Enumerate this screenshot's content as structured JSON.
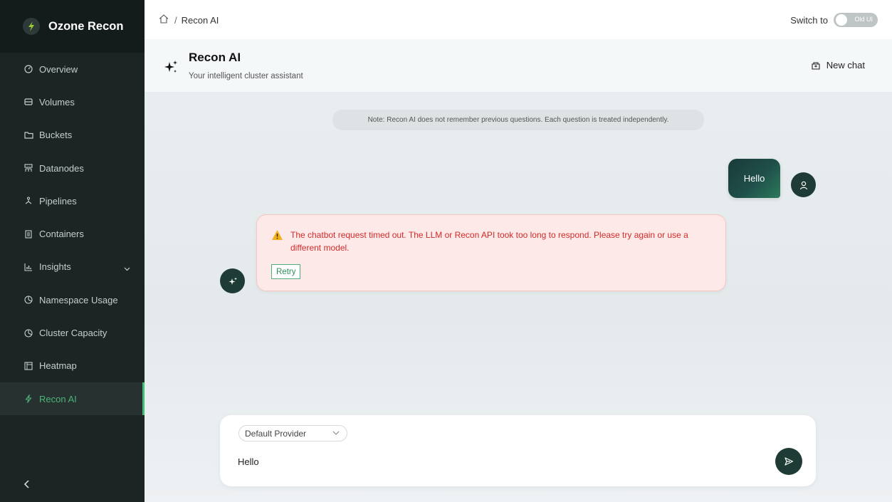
{
  "app": {
    "name": "Ozone Recon"
  },
  "sidebar": {
    "items": [
      {
        "label": "Overview",
        "icon": "dashboard-icon"
      },
      {
        "label": "Volumes",
        "icon": "volume-icon"
      },
      {
        "label": "Buckets",
        "icon": "folder-icon"
      },
      {
        "label": "Datanodes",
        "icon": "cluster-icon"
      },
      {
        "label": "Pipelines",
        "icon": "pipeline-icon"
      },
      {
        "label": "Containers",
        "icon": "container-icon"
      },
      {
        "label": "Insights",
        "icon": "chart-icon",
        "expandable": true
      },
      {
        "label": "Namespace Usage",
        "icon": "pie-icon"
      },
      {
        "label": "Cluster Capacity",
        "icon": "pie-icon"
      },
      {
        "label": "Heatmap",
        "icon": "heatmap-icon"
      },
      {
        "label": "Recon AI",
        "icon": "bolt-icon",
        "active": true
      }
    ]
  },
  "topbar": {
    "breadcrumb": "Recon AI",
    "switch_label": "Switch to",
    "toggle_label": "Old UI"
  },
  "header": {
    "title": "Recon AI",
    "subtitle": "Your intelligent cluster assistant",
    "new_chat_label": "New chat"
  },
  "chat": {
    "note": "Note: Recon AI does not remember previous questions. Each question is treated independently.",
    "user_message": "Hello",
    "error_message": "The chatbot request timed out. The LLM or Recon API took too long to respond. Please try again or use a different model.",
    "retry_label": "Retry"
  },
  "composer": {
    "provider": "Default Provider",
    "input_value": "Hello"
  },
  "colors": {
    "sidebar_bg": "#1c2424",
    "accent": "#3fbf77",
    "error_text": "#d42a2a",
    "error_bg": "#fde9e7",
    "bubble_dark": "#1e3b36"
  }
}
